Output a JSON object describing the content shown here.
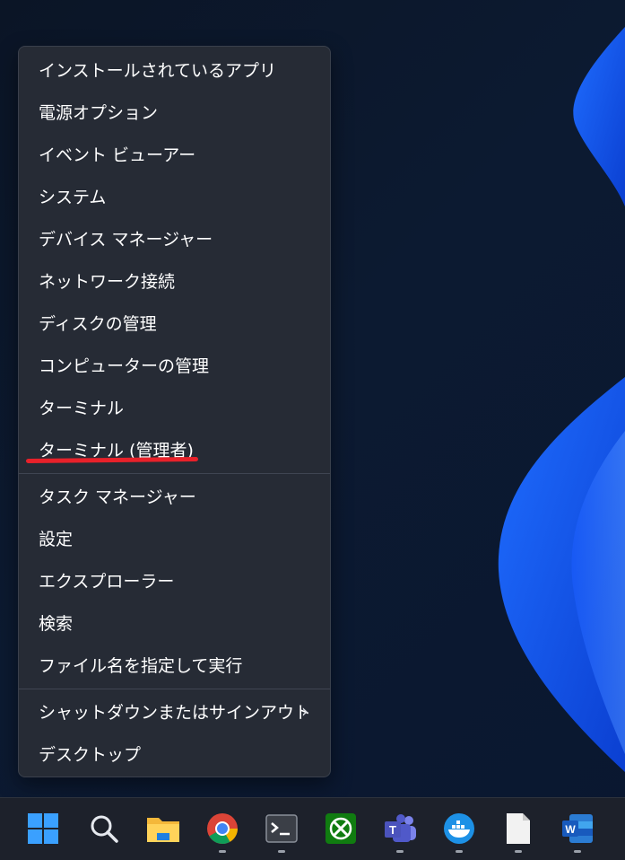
{
  "menu": {
    "items": [
      {
        "label": "インストールされているアプリ"
      },
      {
        "label": "電源オプション"
      },
      {
        "label": "イベント ビューアー"
      },
      {
        "label": "システム"
      },
      {
        "label": "デバイス マネージャー"
      },
      {
        "label": "ネットワーク接続"
      },
      {
        "label": "ディスクの管理"
      },
      {
        "label": "コンピューターの管理"
      },
      {
        "label": "ターミナル"
      },
      {
        "label": "ターミナル (管理者)"
      },
      {
        "label": "タスク マネージャー"
      },
      {
        "label": "設定"
      },
      {
        "label": "エクスプローラー"
      },
      {
        "label": "検索"
      },
      {
        "label": "ファイル名を指定して実行"
      },
      {
        "label": "シャットダウンまたはサインアウト"
      },
      {
        "label": "デスクトップ"
      }
    ],
    "submenu_arrow": "›",
    "highlight_color": "#e8212a"
  },
  "taskbar": {
    "icons": [
      {
        "name": "start-icon"
      },
      {
        "name": "search-icon"
      },
      {
        "name": "file-explorer-icon"
      },
      {
        "name": "chrome-icon"
      },
      {
        "name": "terminal-icon"
      },
      {
        "name": "xbox-icon"
      },
      {
        "name": "teams-icon"
      },
      {
        "name": "docker-icon"
      },
      {
        "name": "file-icon"
      },
      {
        "name": "word-icon"
      }
    ]
  }
}
